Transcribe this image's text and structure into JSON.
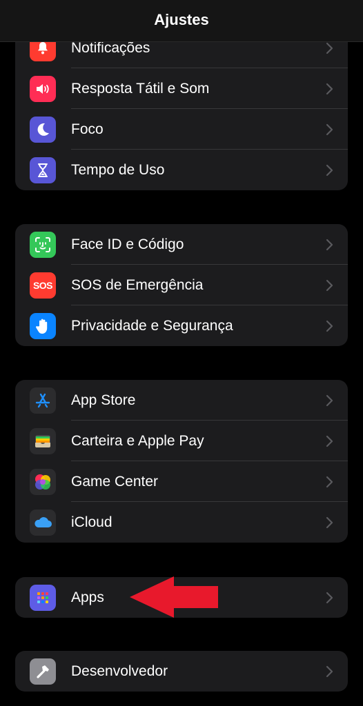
{
  "header": {
    "title": "Ajustes"
  },
  "groups": [
    {
      "items": [
        {
          "label": "Notificações",
          "icon": "bell-icon",
          "color": "#ff3b30"
        },
        {
          "label": "Resposta Tátil e Som",
          "icon": "speaker-icon",
          "color": "#ff2d55"
        },
        {
          "label": "Foco",
          "icon": "moon-icon",
          "color": "#5856d6"
        },
        {
          "label": "Tempo de Uso",
          "icon": "hourglass-icon",
          "color": "#5856d6"
        }
      ]
    },
    {
      "items": [
        {
          "label": "Face ID e Código",
          "icon": "face-id-icon",
          "color": "#34c759"
        },
        {
          "label": "SOS de Emergência",
          "icon": "sos-icon",
          "color": "#ff3b30",
          "icon_text": "SOS"
        },
        {
          "label": "Privacidade e Segurança",
          "icon": "hand-icon",
          "color": "#0a84ff"
        }
      ]
    },
    {
      "items": [
        {
          "label": "App Store",
          "icon": "app-store-icon",
          "color": "#2c2c2e"
        },
        {
          "label": "Carteira e Apple Pay",
          "icon": "wallet-icon",
          "color": "#2c2c2e"
        },
        {
          "label": "Game Center",
          "icon": "game-center-icon",
          "color": "#2c2c2e"
        },
        {
          "label": "iCloud",
          "icon": "icloud-icon",
          "color": "#2c2c2e"
        }
      ]
    },
    {
      "items": [
        {
          "label": "Apps",
          "icon": "apps-grid-icon",
          "color": "#5e5ce6"
        }
      ]
    },
    {
      "items": [
        {
          "label": "Desenvolvedor",
          "icon": "hammer-icon",
          "color": "#8e8e93"
        }
      ]
    }
  ],
  "annotation": {
    "arrow": "red-arrow-pointing-left",
    "color": "#e8192c"
  }
}
